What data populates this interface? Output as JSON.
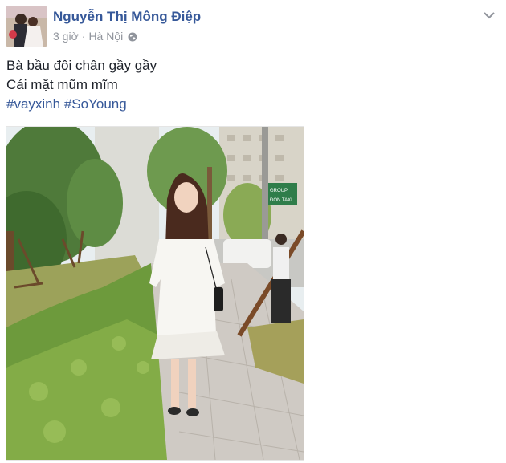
{
  "post": {
    "author": "Nguyễn Thị Mông Điệp",
    "time": "3 giờ",
    "separator": "·",
    "location": "Hà Nội",
    "privacy_icon": "globe-icon",
    "menu_icon": "chevron-down-icon",
    "lines": [
      "Bà bầu đôi chân gầy gầy",
      "Cái mặt mũm mĩm"
    ],
    "hashtags": [
      "#vayxinh",
      "#SoYoung"
    ],
    "sign": {
      "line1": "GROUP",
      "line2": "ĐÓN TAXI"
    }
  },
  "colors": {
    "link": "#365899",
    "text": "#1d2129",
    "meta": "#90949c",
    "sign_green": "#2f7d4a"
  }
}
